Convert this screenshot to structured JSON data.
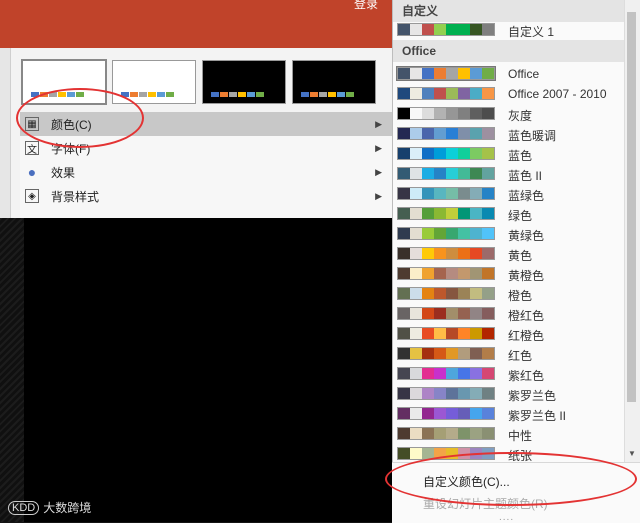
{
  "header": {
    "login": "登录"
  },
  "themes": [
    {
      "style": "white",
      "selected": true,
      "bars": [
        "#4472c4",
        "#ed7d31",
        "#a5a5a5",
        "#ffc000",
        "#5b9bd5",
        "#70ad47"
      ]
    },
    {
      "style": "white",
      "selected": false,
      "bars": [
        "#4472c4",
        "#ed7d31",
        "#a5a5a5",
        "#ffc000",
        "#5b9bd5",
        "#70ad47"
      ]
    },
    {
      "style": "black",
      "selected": false,
      "bars": [
        "#4472c4",
        "#ed7d31",
        "#a5a5a5",
        "#ffc000",
        "#5b9bd5",
        "#70ad47"
      ]
    },
    {
      "style": "black",
      "selected": false,
      "bars": [
        "#4472c4",
        "#ed7d31",
        "#a5a5a5",
        "#ffc000",
        "#5b9bd5",
        "#70ad47"
      ]
    }
  ],
  "submenu": [
    {
      "label": "颜色(C)",
      "icon": "palette-icon",
      "active": true
    },
    {
      "label": "字体(F)",
      "icon": "font-icon",
      "active": false
    },
    {
      "label": "效果",
      "icon": "effects-icon",
      "active": false
    },
    {
      "label": "背景样式",
      "icon": "background-style-icon",
      "active": false
    }
  ],
  "dropdown": {
    "section_custom": "自定义",
    "custom_rows": [
      {
        "name": "自定义 1",
        "colors": [
          "#44546a",
          "#e7e6e6",
          "#c0504d",
          "#92d050",
          "#00b050",
          "#00b050",
          "#375623",
          "#7f7f7f"
        ]
      }
    ],
    "section_office": "Office",
    "office_rows": [
      {
        "name": "Office",
        "selected": true,
        "colors": [
          "#44546a",
          "#e7e6e6",
          "#4472c4",
          "#ed7d31",
          "#a5a5a5",
          "#ffc000",
          "#5b9bd5",
          "#70ad47"
        ]
      },
      {
        "name": "Office 2007 - 2010",
        "selected": false,
        "colors": [
          "#1f497d",
          "#eeece1",
          "#4f81bd",
          "#c0504d",
          "#9bbb59",
          "#8064a2",
          "#4bacc6",
          "#f79646"
        ]
      },
      {
        "name": "灰度",
        "selected": false,
        "colors": [
          "#000000",
          "#f8f8f8",
          "#dddddd",
          "#b2b2b2",
          "#969696",
          "#808080",
          "#5f5f5f",
          "#4d4d4d"
        ]
      },
      {
        "name": "蓝色暖调",
        "selected": false,
        "colors": [
          "#242852",
          "#acccea",
          "#4a66ac",
          "#629dd1",
          "#297fd5",
          "#7f8fa9",
          "#5aa2ae",
          "#9d90a0"
        ]
      },
      {
        "name": "蓝色",
        "selected": false,
        "colors": [
          "#17406d",
          "#dbeff9",
          "#0f6fc6",
          "#009dd9",
          "#0bd0d9",
          "#10cf9b",
          "#7cca62",
          "#a5c249"
        ]
      },
      {
        "name": "蓝色 II",
        "selected": false,
        "colors": [
          "#335b74",
          "#dfe3e5",
          "#1cade4",
          "#2683c6",
          "#27ced7",
          "#42ba97",
          "#3e8853",
          "#62a39f"
        ]
      },
      {
        "name": "蓝绿色",
        "selected": false,
        "colors": [
          "#373545",
          "#ceecf8",
          "#3494ba",
          "#58b6c0",
          "#75bda7",
          "#7a8c8e",
          "#84acb6",
          "#2683c6"
        ]
      },
      {
        "name": "绿色",
        "selected": false,
        "colors": [
          "#455f51",
          "#e3ded1",
          "#549e39",
          "#8ab833",
          "#c0cf3a",
          "#029676",
          "#4ab5c4",
          "#0989b1"
        ]
      },
      {
        "name": "黄绿色",
        "selected": false,
        "colors": [
          "#2f3b4f",
          "#e3ded1",
          "#99cb38",
          "#63a537",
          "#37a76f",
          "#44c1a3",
          "#4eb3cf",
          "#51c3f9"
        ]
      },
      {
        "name": "黄色",
        "selected": false,
        "colors": [
          "#39302a",
          "#e5dedb",
          "#ffca08",
          "#f8931d",
          "#ce8d3e",
          "#ec7016",
          "#e64823",
          "#9c6a6a"
        ]
      },
      {
        "name": "黄橙色",
        "selected": false,
        "colors": [
          "#4e3b30",
          "#fbeec9",
          "#f0a22e",
          "#a5644e",
          "#b58b80",
          "#c3986d",
          "#a19574",
          "#c17529"
        ]
      },
      {
        "name": "橙色",
        "selected": false,
        "colors": [
          "#637052",
          "#ccddea",
          "#e48312",
          "#bd582c",
          "#865640",
          "#9b8357",
          "#c2bc80",
          "#94a088"
        ]
      },
      {
        "name": "橙红色",
        "selected": false,
        "colors": [
          "#696464",
          "#e9e5dc",
          "#d34817",
          "#9b2d1f",
          "#a28e6a",
          "#956251",
          "#918485",
          "#855d5d"
        ]
      },
      {
        "name": "红橙色",
        "selected": false,
        "colors": [
          "#505046",
          "#eeece1",
          "#e84c22",
          "#ffbd47",
          "#b64926",
          "#ff8427",
          "#cc9900",
          "#b22600"
        ]
      },
      {
        "name": "红色",
        "selected": false,
        "colors": [
          "#323232",
          "#e5c243",
          "#a5300f",
          "#d55816",
          "#e19825",
          "#b19c7d",
          "#7f5f52",
          "#b27d49"
        ]
      },
      {
        "name": "紫红色",
        "selected": false,
        "colors": [
          "#454551",
          "#d8d9dc",
          "#e32d91",
          "#c830cc",
          "#4ea6dc",
          "#4775e7",
          "#8971e1",
          "#d54773"
        ]
      },
      {
        "name": "紫罗兰色",
        "selected": false,
        "colors": [
          "#373545",
          "#dcd8dc",
          "#ad84c6",
          "#8784c7",
          "#5d739a",
          "#6997af",
          "#84acb6",
          "#6f8183"
        ]
      },
      {
        "name": "紫罗兰色 II",
        "selected": false,
        "colors": [
          "#632e62",
          "#eaeaea",
          "#92278f",
          "#9b57d3",
          "#755dd9",
          "#665eb8",
          "#45a5ed",
          "#5982db"
        ]
      },
      {
        "name": "中性",
        "selected": false,
        "colors": [
          "#4e3b30",
          "#ebddc3",
          "#8b7355",
          "#a59f75",
          "#b4ab8a",
          "#7e936a",
          "#9ba282",
          "#8a9073"
        ]
      },
      {
        "name": "纸张",
        "selected": false,
        "colors": [
          "#444d26",
          "#fefac9",
          "#a5b592",
          "#f3a447",
          "#e7bc29",
          "#d092a7",
          "#9c85c0",
          "#809ec2"
        ]
      }
    ],
    "custom_color_label": "自定义颜色(C)...",
    "reset_color_label": "重设幻灯片主题颜色(R)",
    "resize_grip": "....",
    "scroll_down": "▼"
  },
  "watermark": {
    "logo": "KDD",
    "text": "大数跨境"
  },
  "annotation_color": "#e33333"
}
